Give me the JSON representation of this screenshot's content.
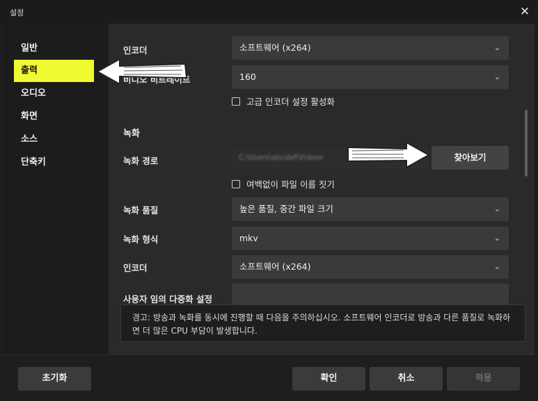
{
  "window": {
    "title": "설정",
    "close_glyph": "✕"
  },
  "sidebar": {
    "items": [
      {
        "label": "일반",
        "active": false
      },
      {
        "label": "출력",
        "active": true
      },
      {
        "label": "오디오",
        "active": false
      },
      {
        "label": "화면",
        "active": false
      },
      {
        "label": "소스",
        "active": false
      },
      {
        "label": "단축키",
        "active": false
      }
    ]
  },
  "streaming": {
    "encoder_label": "인코더",
    "encoder_value": "소프트웨어 (x264)",
    "bitrate_label": "비디오 비트레이트",
    "bitrate_value": "160",
    "advanced_checkbox": "고급 인코더 설정 활성화"
  },
  "recording": {
    "section_title": "녹화",
    "path_label": "녹화 경로",
    "path_value": "C:\\Users\\abcdef\\Videos",
    "browse_button": "찾아보기",
    "no_space_checkbox": "여백없이 파일 이름 짓기",
    "quality_label": "녹화 품질",
    "quality_value": "높은 품질, 중간 파일 크기",
    "format_label": "녹화 형식",
    "format_value": "mkv",
    "encoder_label": "인코더",
    "encoder_value": "소프트웨어 (x264)",
    "mux_label": "사용자 임의 다중화 설정"
  },
  "warning_text": "경고: 방송과 녹화를 동시에 진행할 때 다음을 주의하십시오. 소프트웨어 인코더로 방송과 다른 품질로 녹화하면 더 많은 CPU 부담이 발생합니다.",
  "footer": {
    "reset": "초기화",
    "ok": "확인",
    "cancel": "취소",
    "apply": "적용"
  },
  "icons": {
    "chevron": "chevron-down-icon",
    "annotation_arrows": "hand-drawn-arrow-icon"
  },
  "colors": {
    "active_tab": "#f0fa30",
    "background": "#2a2a2a"
  }
}
